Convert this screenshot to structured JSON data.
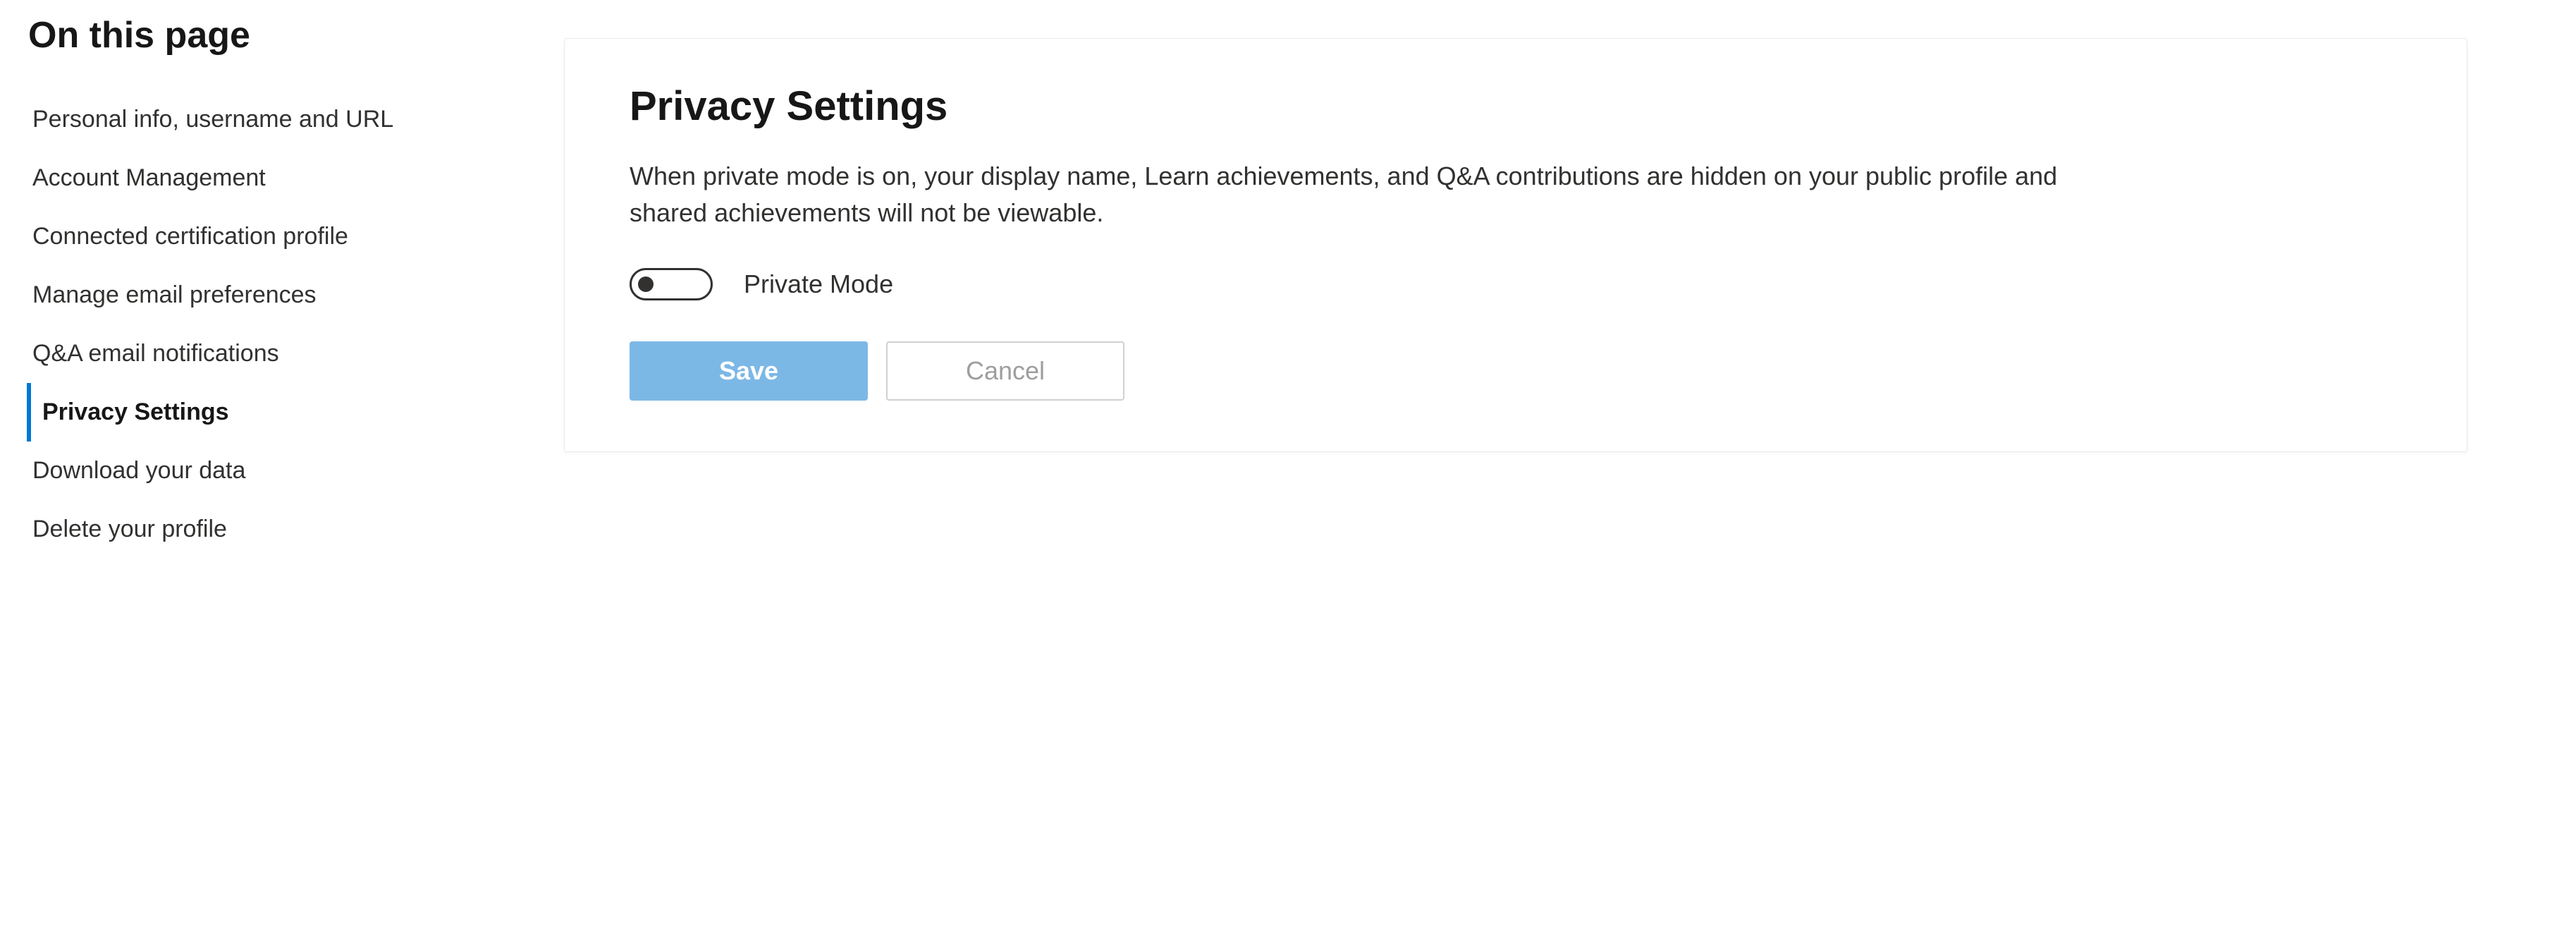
{
  "sidebar": {
    "title": "On this page",
    "items": [
      {
        "label": "Personal info, username and URL",
        "active": false
      },
      {
        "label": "Account Management",
        "active": false
      },
      {
        "label": "Connected certification profile",
        "active": false
      },
      {
        "label": "Manage email preferences",
        "active": false
      },
      {
        "label": "Q&A email notifications",
        "active": false
      },
      {
        "label": "Privacy Settings",
        "active": true
      },
      {
        "label": "Download your data",
        "active": false
      },
      {
        "label": "Delete your profile",
        "active": false
      }
    ]
  },
  "main": {
    "heading": "Privacy Settings",
    "description": "When private mode is on, your display name, Learn achievements, and Q&A contributions are hidden on your public profile and shared achievements will not be viewable.",
    "toggle": {
      "label": "Private Mode",
      "state": "off"
    },
    "buttons": {
      "save": "Save",
      "cancel": "Cancel"
    }
  }
}
